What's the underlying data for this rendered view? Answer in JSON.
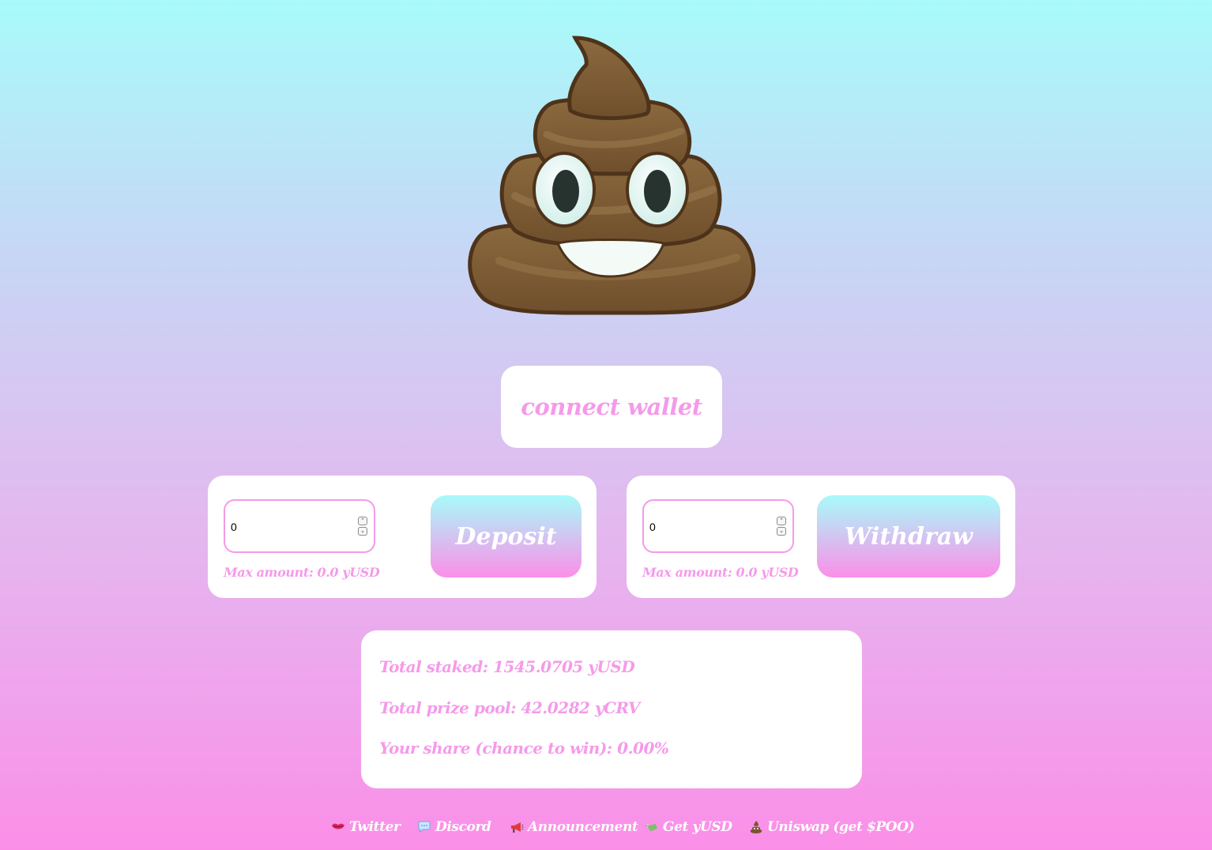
{
  "connect_wallet": {
    "label": "connect wallet"
  },
  "deposit": {
    "amount_value": "0",
    "max_amount": "Max amount: 0.0 yUSD",
    "button_label": "Deposit"
  },
  "withdraw": {
    "amount_value": "0",
    "max_amount": "Max amount: 0.0 yUSD",
    "button_label": "Withdraw"
  },
  "stats": {
    "total_staked": "Total staked: 1545.0705 yUSD",
    "total_prize_pool": "Total prize pool: 42.0282 yCRV",
    "your_share": "Your share (chance to win): 0.00%"
  },
  "footer": {
    "links": [
      {
        "label": "Twitter",
        "icon": "lips-icon"
      },
      {
        "label": "Discord",
        "icon": "speech-bubble-icon"
      },
      {
        "label": "Announcement",
        "icon": "megaphone-icon"
      },
      {
        "label": "Get yUSD",
        "icon": "money-with-wings-icon"
      },
      {
        "label": "Uniswap (get $POO)",
        "icon": "poop-icon"
      }
    ]
  },
  "colors": {
    "accent_pink": "#f59ae9",
    "gradient_top": "#a8fbfa",
    "gradient_bottom": "#fb8fe8",
    "card_background": "#ffffff"
  }
}
